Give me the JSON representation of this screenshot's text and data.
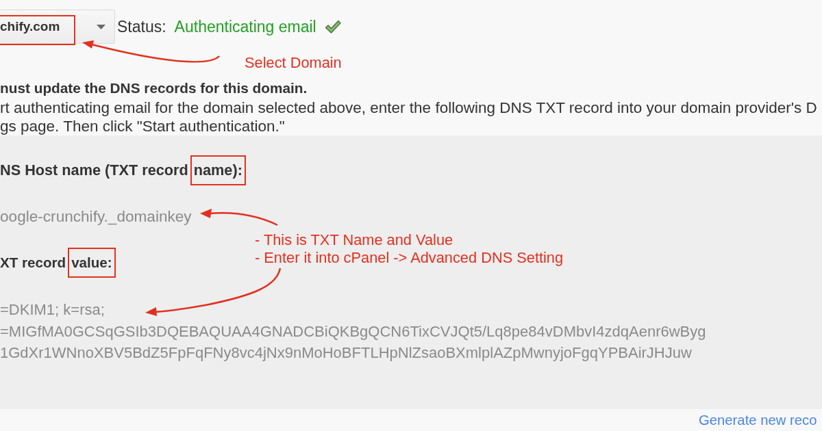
{
  "domain_select": {
    "value": "chify.com"
  },
  "status": {
    "label": "Status:",
    "value": "Authenticating email"
  },
  "notice": {
    "heading": "nust update the DNS records for this domain.",
    "lines": [
      "rt authenticating email for the domain selected above, enter the following DNS TXT record into your domain provider's D",
      "gs page. Then click \"Start authentication.\""
    ]
  },
  "record": {
    "host_label": {
      "text": "NS Host name (TXT record",
      "boxed": "name):"
    },
    "host_value": "oogle-crunchify._domainkey",
    "value_label": {
      "text": "XT record",
      "boxed": "value:"
    },
    "value_lines": [
      "=DKIM1; k=rsa;",
      "=MIGfMA0GCSqGSIb3DQEBAQUAA4GNADCBiQKBgQCN6TixCVJQt5/Lq8pe84vDMbvI4zdqAenr6wByg",
      "1GdXr1WNnoXBV5BdZ5FpFqFNy8vc4jNx9nMoHoBFTLHpNlZsaoBXmlplAZpMwnyjoFgqYPBAirJHJuw"
    ]
  },
  "annotations": [
    {
      "lines": [
        "Select Domain"
      ]
    },
    {
      "lines": [
        "- This is TXT Name and Value",
        "- Enter it into cPanel -> Advanced DNS Setting"
      ]
    }
  ],
  "footer": {
    "link": "Generate new reco"
  }
}
